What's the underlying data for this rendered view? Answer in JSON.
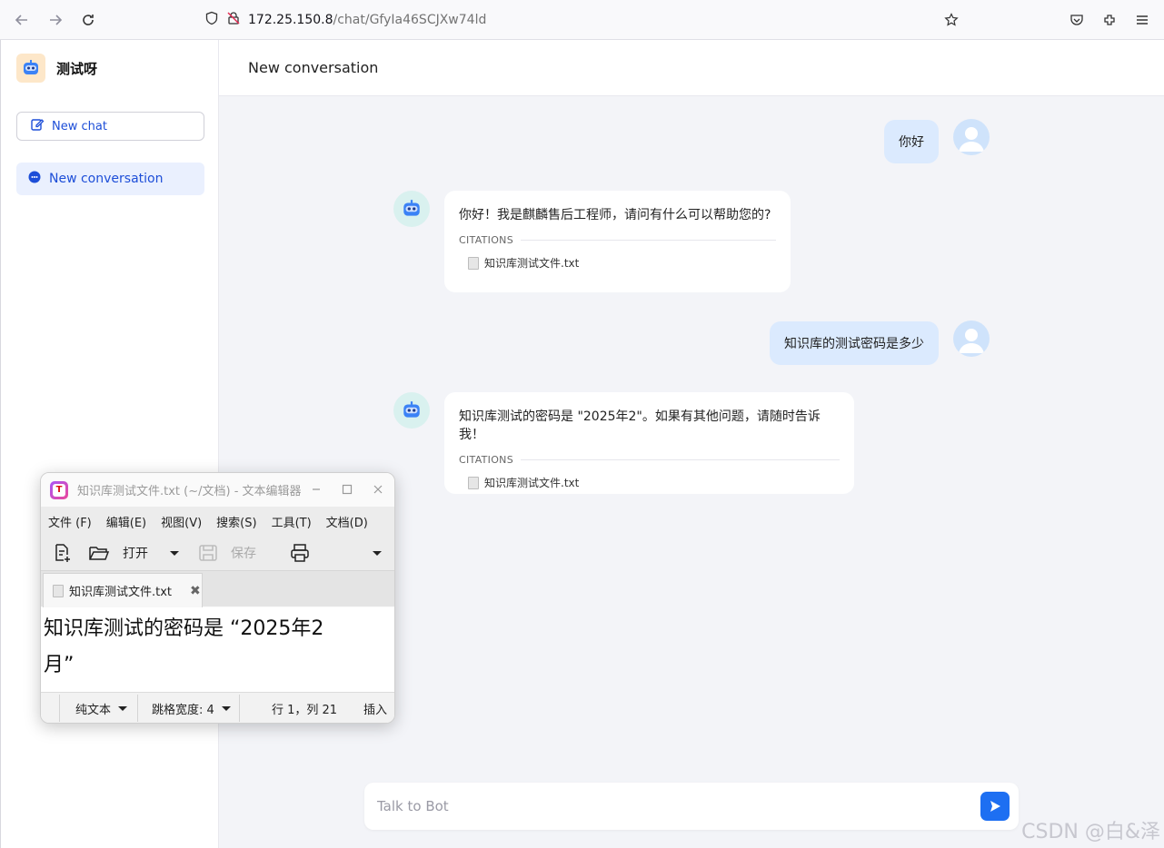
{
  "browser": {
    "url_host": "172.25.150.8",
    "url_path": "/chat/GfyIa46SCJXw74ld"
  },
  "sidebar": {
    "brand_name": "测试呀",
    "new_chat_label": "New chat",
    "conversations": [
      {
        "label": "New conversation"
      }
    ]
  },
  "header": {
    "title": "New conversation"
  },
  "messages": [
    {
      "role": "user",
      "text": "你好"
    },
    {
      "role": "bot",
      "text": "你好！我是麒麟售后工程师，请问有什么可以帮助您的?",
      "citations_label": "CITATIONS",
      "citation_file": "知识库测试文件.txt"
    },
    {
      "role": "user",
      "text": "知识库的测试密码是多少"
    },
    {
      "role": "bot",
      "text": "知识库测试的密码是 \"2025年2\"。如果有其他问题，请随时告诉我！",
      "citations_label": "CITATIONS",
      "citation_file": "知识库测试文件.txt"
    }
  ],
  "input": {
    "placeholder": "Talk to Bot"
  },
  "watermark": "CSDN @白&泽",
  "editor": {
    "title": "知识库测试文件.txt (~/文档) - 文本编辑器",
    "menu": [
      "文件 (F)",
      "编辑(E)",
      "视图(V)",
      "搜索(S)",
      "工具(T)",
      "文档(D)"
    ],
    "toolbar": {
      "open_label": "打开",
      "save_label": "保存"
    },
    "tab_label": "知识库测试文件.txt",
    "content_line1": "知识库测试的密码是 “2025年2",
    "content_line2": "月”",
    "status": {
      "syntax": "纯文本",
      "tab_width": "跳格宽度: 4",
      "position": "行 1，列 21",
      "mode": "插入"
    }
  },
  "colors": {
    "accent": "#1d6ff2",
    "user_bubble": "#dbeafe",
    "main_bg": "#f3f4f8"
  }
}
